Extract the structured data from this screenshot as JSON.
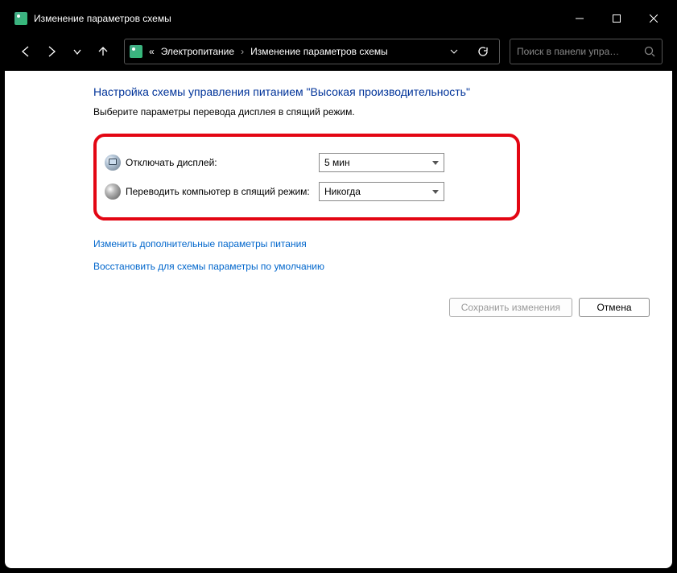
{
  "window": {
    "title": "Изменение параметров схемы"
  },
  "breadcrumb": {
    "prefix": "«",
    "item1": "Электропитание",
    "item2": "Изменение параметров схемы"
  },
  "search": {
    "placeholder": "Поиск в панели упра…"
  },
  "page": {
    "heading": "Настройка схемы управления питанием \"Высокая производительность\"",
    "subheading": "Выберите параметры перевода дисплея в спящий режим."
  },
  "settings": {
    "display_off_label": "Отключать дисплей:",
    "display_off_value": "5 мин",
    "sleep_label": "Переводить компьютер в спящий режим:",
    "sleep_value": "Никогда"
  },
  "links": {
    "advanced": "Изменить дополнительные параметры питания",
    "restore": "Восстановить для схемы параметры по умолчанию"
  },
  "buttons": {
    "save": "Сохранить изменения",
    "cancel": "Отмена"
  }
}
